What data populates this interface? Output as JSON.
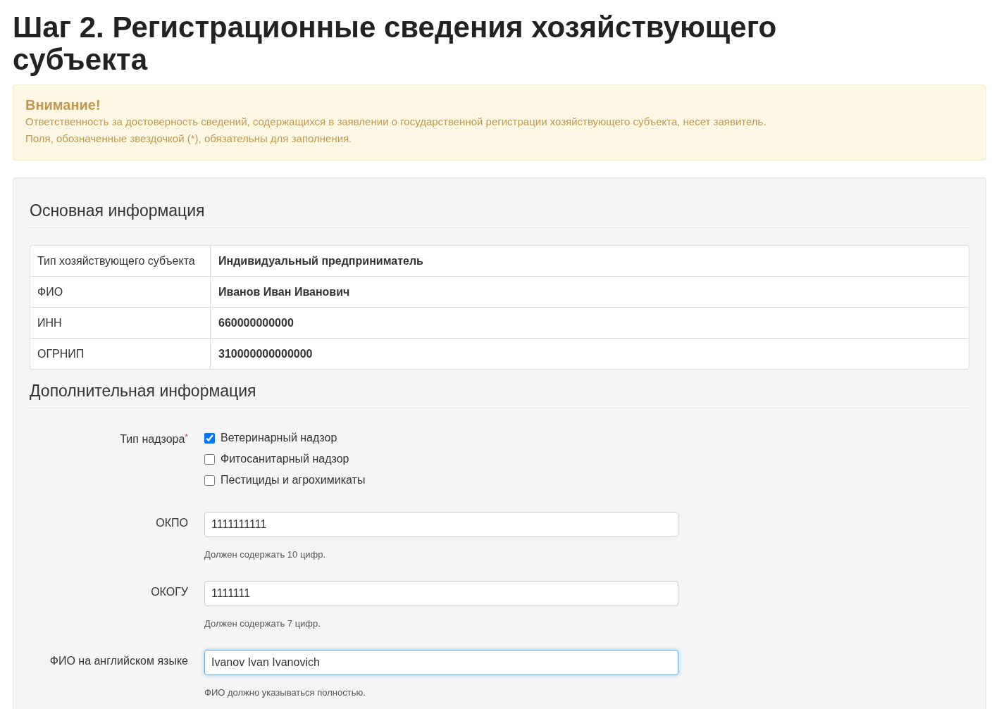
{
  "page_title": "Шаг 2. Регистрационные сведения хозяйствующего субъекта",
  "alert": {
    "title": "Внимание!",
    "lines": [
      "Ответственность за достоверность сведений, содержащихся в заявлении о государственной регистрации хозяйствующего субъекта, несет заявитель.",
      "Поля, обозначенные звездочкой (*), обязательны для заполнения."
    ]
  },
  "main_section": {
    "title": "Основная информация",
    "rows": [
      {
        "label": "Тип хозяйствующего субъекта",
        "value": "Индивидуальный предприниматель"
      },
      {
        "label": "ФИО",
        "value": "Иванов Иван Иванович"
      },
      {
        "label": "ИНН",
        "value": "660000000000"
      },
      {
        "label": "ОГРНИП",
        "value": "310000000000000"
      }
    ]
  },
  "extra_section": {
    "title": "Дополнительная информация",
    "fields": [
      {
        "kind": "checkboxes",
        "label": "Тип надзора",
        "required_mark": "*",
        "options": [
          {
            "label": "Ветеринарный надзор",
            "checked": true
          },
          {
            "label": "Фитосанитарный надзор",
            "checked": false
          },
          {
            "label": "Пестициды и агрохимикаты",
            "checked": false
          }
        ]
      },
      {
        "kind": "text",
        "label": "ОКПО",
        "value": "1111111111",
        "focused": false,
        "help": "Должен содержать 10 цифр."
      },
      {
        "kind": "text",
        "label": "ОКОГУ",
        "value": "1111111",
        "focused": false,
        "help": "Должен содержать 7 цифр."
      },
      {
        "kind": "text",
        "label": "ФИО на английском языке",
        "value": "Ivanov Ivan Ivanovich",
        "focused": true,
        "help": "ФИО должно указываться полностью."
      }
    ]
  }
}
